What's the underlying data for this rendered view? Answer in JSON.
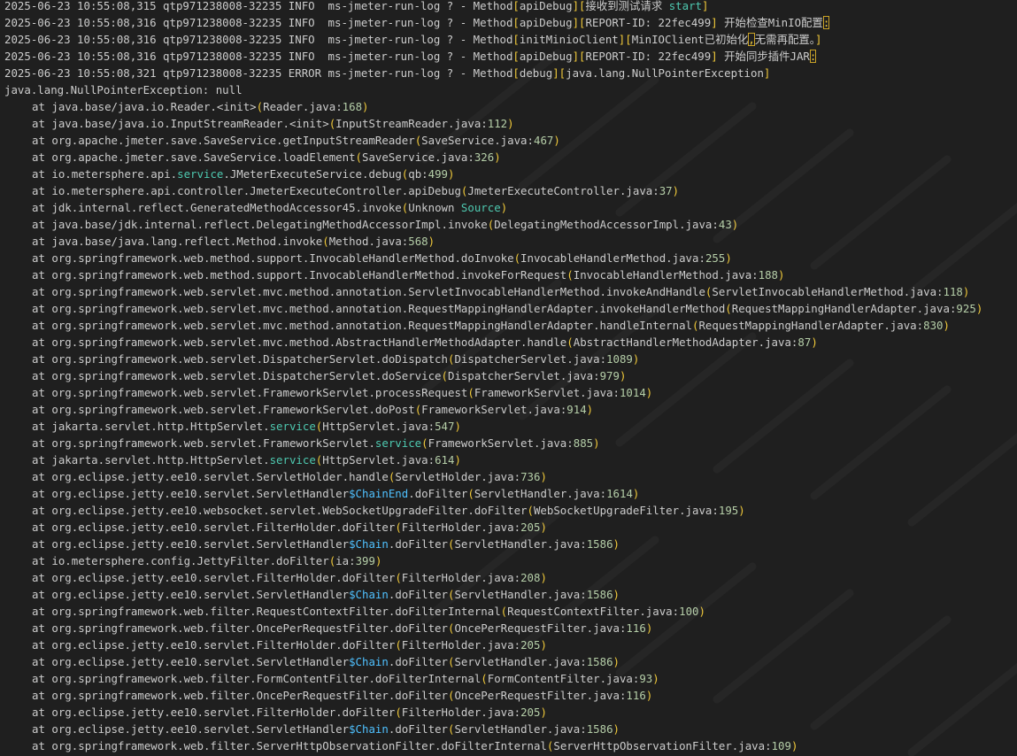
{
  "log": {
    "header_lines": [
      {
        "prefix": "2025-06-23 10:55:08,315 qtp971238008-32235 INFO  ms-jmeter-run-log ? - Method",
        "parts": [
          "[",
          "apiDebug",
          "][",
          "接收到测试请求 start",
          "]"
        ]
      },
      {
        "prefix": "2025-06-23 10:55:08,316 qtp971238008-32235 INFO  ms-jmeter-run-log ? - Method",
        "parts": [
          "[",
          "apiDebug",
          "][",
          "REPORT-ID: 22fec499",
          "]",
          " 开始检查MinIO配置",
          ":"
        ]
      },
      {
        "prefix": "2025-06-23 10:55:08,316 qtp971238008-32235 INFO  ms-jmeter-run-log ? - Method",
        "parts": [
          "[",
          "initMinioClient",
          "][",
          "MinIOClient已初始化",
          ",",
          "无需再配置。",
          "]"
        ]
      },
      {
        "prefix": "2025-06-23 10:55:08,316 qtp971238008-32235 INFO  ms-jmeter-run-log ? - Method",
        "parts": [
          "[",
          "apiDebug",
          "][",
          "REPORT-ID: 22fec499",
          "]",
          " 开始同步插件JAR",
          ":"
        ]
      },
      {
        "prefix": "2025-06-23 10:55:08,321 qtp971238008-32235 ERROR ms-jmeter-run-log ? - Method",
        "parts": [
          "[",
          "debug",
          "][",
          "java.lang.NullPointerException",
          "]"
        ]
      }
    ],
    "exception_line": "java.lang.NullPointerException: null",
    "stack_prefix": "at",
    "stack_frames": [
      {
        "pre": "java.base/java.io.Reader.<init>",
        "kw": "",
        "post": "",
        "file": "Reader.java",
        "line": "168"
      },
      {
        "pre": "java.base/java.io.InputStreamReader.<init>",
        "kw": "",
        "post": "",
        "file": "InputStreamReader.java",
        "line": "112"
      },
      {
        "pre": "org.apache.jmeter.save.SaveService.getInputStreamReader",
        "kw": "",
        "post": "",
        "file": "SaveService.java",
        "line": "467"
      },
      {
        "pre": "org.apache.jmeter.save.SaveService.loadElement",
        "kw": "",
        "post": "",
        "file": "SaveService.java",
        "line": "326"
      },
      {
        "pre": "io.metersphere.api.",
        "kw": "service",
        "post": ".JMeterExecuteService.debug",
        "file": "qb",
        "line": "499"
      },
      {
        "pre": "io.metersphere.api.controller.JmeterExecuteController.apiDebug",
        "kw": "",
        "post": "",
        "file": "JmeterExecuteController.java",
        "line": "37"
      },
      {
        "pre": "jdk.internal.reflect.GeneratedMethodAccessor45.invoke",
        "kw": "",
        "post": "",
        "file": "Unknown ",
        "kwfile": "Source",
        "line": ""
      },
      {
        "pre": "java.base/jdk.internal.reflect.DelegatingMethodAccessorImpl.invoke",
        "kw": "",
        "post": "",
        "file": "DelegatingMethodAccessorImpl.java",
        "line": "43"
      },
      {
        "pre": "java.base/java.lang.reflect.Method.invoke",
        "kw": "",
        "post": "",
        "file": "Method.java",
        "line": "568"
      },
      {
        "pre": "org.springframework.web.method.support.InvocableHandlerMethod.doInvoke",
        "kw": "",
        "post": "",
        "file": "InvocableHandlerMethod.java",
        "line": "255"
      },
      {
        "pre": "org.springframework.web.method.support.InvocableHandlerMethod.invokeForRequest",
        "kw": "",
        "post": "",
        "file": "InvocableHandlerMethod.java",
        "line": "188"
      },
      {
        "pre": "org.springframework.web.servlet.mvc.method.annotation.ServletInvocableHandlerMethod.invokeAndHandle",
        "kw": "",
        "post": "",
        "file": "ServletInvocableHandlerMethod.java",
        "line": "118"
      },
      {
        "pre": "org.springframework.web.servlet.mvc.method.annotation.RequestMappingHandlerAdapter.invokeHandlerMethod",
        "kw": "",
        "post": "",
        "file": "RequestMappingHandlerAdapter.java",
        "line": "925"
      },
      {
        "pre": "org.springframework.web.servlet.mvc.method.annotation.RequestMappingHandlerAdapter.handleInternal",
        "kw": "",
        "post": "",
        "file": "RequestMappingHandlerAdapter.java",
        "line": "830"
      },
      {
        "pre": "org.springframework.web.servlet.mvc.method.AbstractHandlerMethodAdapter.handle",
        "kw": "",
        "post": "",
        "file": "AbstractHandlerMethodAdapter.java",
        "line": "87"
      },
      {
        "pre": "org.springframework.web.servlet.DispatcherServlet.doDispatch",
        "kw": "",
        "post": "",
        "file": "DispatcherServlet.java",
        "line": "1089"
      },
      {
        "pre": "org.springframework.web.servlet.DispatcherServlet.doService",
        "kw": "",
        "post": "",
        "file": "DispatcherServlet.java",
        "line": "979"
      },
      {
        "pre": "org.springframework.web.servlet.FrameworkServlet.processRequest",
        "kw": "",
        "post": "",
        "file": "FrameworkServlet.java",
        "line": "1014"
      },
      {
        "pre": "org.springframework.web.servlet.FrameworkServlet.doPost",
        "kw": "",
        "post": "",
        "file": "FrameworkServlet.java",
        "line": "914"
      },
      {
        "pre": "jakarta.servlet.http.HttpServlet.",
        "kw": "service",
        "post": "",
        "file": "HttpServlet.java",
        "line": "547"
      },
      {
        "pre": "org.springframework.web.servlet.FrameworkServlet.",
        "kw": "service",
        "post": "",
        "file": "FrameworkServlet.java",
        "line": "885"
      },
      {
        "pre": "jakarta.servlet.http.HttpServlet.",
        "kw": "service",
        "post": "",
        "file": "HttpServlet.java",
        "line": "614"
      },
      {
        "pre": "org.eclipse.jetty.ee10.servlet.ServletHolder.handle",
        "kw": "",
        "post": "",
        "file": "ServletHolder.java",
        "line": "736"
      },
      {
        "pre": "org.eclipse.jetty.ee10.servlet.ServletHandler",
        "sym": "$ChainEnd",
        "post": ".doFilter",
        "file": "ServletHandler.java",
        "line": "1614"
      },
      {
        "pre": "org.eclipse.jetty.ee10.websocket.servlet.WebSocketUpgradeFilter.doFilter",
        "kw": "",
        "post": "",
        "file": "WebSocketUpgradeFilter.java",
        "line": "195"
      },
      {
        "pre": "org.eclipse.jetty.ee10.servlet.FilterHolder.doFilter",
        "kw": "",
        "post": "",
        "file": "FilterHolder.java",
        "line": "205"
      },
      {
        "pre": "org.eclipse.jetty.ee10.servlet.ServletHandler",
        "sym": "$Chain",
        "post": ".doFilter",
        "file": "ServletHandler.java",
        "line": "1586"
      },
      {
        "pre": "io.metersphere.config.JettyFilter.doFilter",
        "kw": "",
        "post": "",
        "file": "ia",
        "line": "399"
      },
      {
        "pre": "org.eclipse.jetty.ee10.servlet.FilterHolder.doFilter",
        "kw": "",
        "post": "",
        "file": "FilterHolder.java",
        "line": "208"
      },
      {
        "pre": "org.eclipse.jetty.ee10.servlet.ServletHandler",
        "sym": "$Chain",
        "post": ".doFilter",
        "file": "ServletHandler.java",
        "line": "1586"
      },
      {
        "pre": "org.springframework.web.filter.RequestContextFilter.doFilterInternal",
        "kw": "",
        "post": "",
        "file": "RequestContextFilter.java",
        "line": "100"
      },
      {
        "pre": "org.springframework.web.filter.OncePerRequestFilter.doFilter",
        "kw": "",
        "post": "",
        "file": "OncePerRequestFilter.java",
        "line": "116"
      },
      {
        "pre": "org.eclipse.jetty.ee10.servlet.FilterHolder.doFilter",
        "kw": "",
        "post": "",
        "file": "FilterHolder.java",
        "line": "205"
      },
      {
        "pre": "org.eclipse.jetty.ee10.servlet.ServletHandler",
        "sym": "$Chain",
        "post": ".doFilter",
        "file": "ServletHandler.java",
        "line": "1586"
      },
      {
        "pre": "org.springframework.web.filter.FormContentFilter.doFilterInternal",
        "kw": "",
        "post": "",
        "file": "FormContentFilter.java",
        "line": "93"
      },
      {
        "pre": "org.springframework.web.filter.OncePerRequestFilter.doFilter",
        "kw": "",
        "post": "",
        "file": "OncePerRequestFilter.java",
        "line": "116"
      },
      {
        "pre": "org.eclipse.jetty.ee10.servlet.FilterHolder.doFilter",
        "kw": "",
        "post": "",
        "file": "FilterHolder.java",
        "line": "205"
      },
      {
        "pre": "org.eclipse.jetty.ee10.servlet.ServletHandler",
        "sym": "$Chain",
        "post": ".doFilter",
        "file": "ServletHandler.java",
        "line": "1586"
      },
      {
        "pre": "org.springframework.web.filter.ServerHttpObservationFilter.doFilterInternal",
        "kw": "",
        "post": "",
        "file": "ServerHttpObservationFilter.java",
        "line": "109"
      }
    ]
  },
  "colors": {
    "background": "#1f1f1f",
    "text": "#cccccc",
    "bracket": "#f0c93a",
    "number": "#b5cea8",
    "keyword": "#4ec9b0",
    "symbol": "#4fc1ff"
  }
}
